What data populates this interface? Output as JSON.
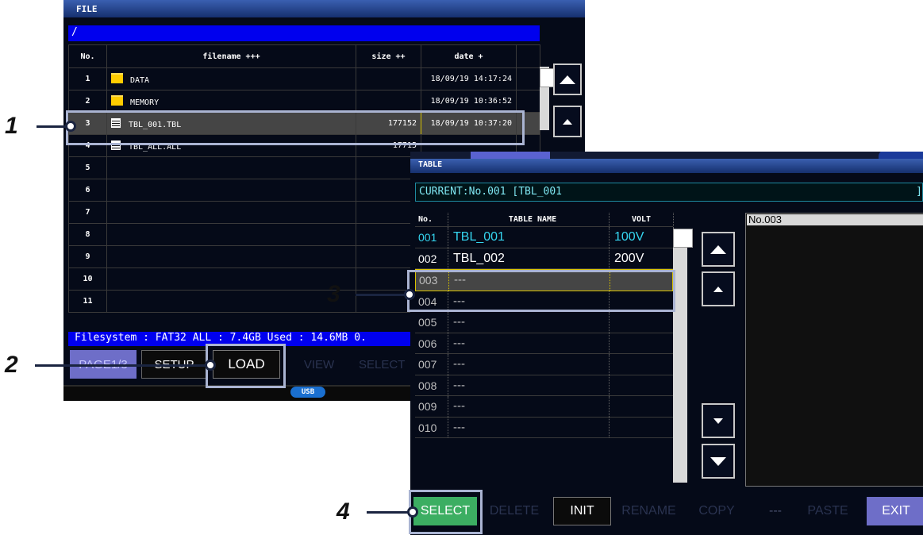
{
  "file_screen": {
    "title": "FILE",
    "path": "/",
    "columns": {
      "no": "No.",
      "filename": "filename +++",
      "size": "size ++",
      "date": "date +"
    },
    "rows": [
      {
        "no": "1",
        "icon": "folder-icon",
        "name": "DATA",
        "size": "",
        "date": "18/09/19 14:17:24"
      },
      {
        "no": "2",
        "icon": "folder-icon",
        "name": "MEMORY",
        "size": "",
        "date": "18/09/19 10:36:52"
      },
      {
        "no": "3",
        "icon": "table-file-icon",
        "name": "TBL_001.TBL",
        "size": "177152",
        "date": "18/09/19 10:37:20",
        "selected": true
      },
      {
        "no": "4",
        "icon": "table-file-icon",
        "name": "TBL_ALL.ALL",
        "size": "17715",
        "date": ""
      },
      {
        "no": "5",
        "name": "",
        "size": "",
        "date": ""
      },
      {
        "no": "6",
        "name": "",
        "size": "",
        "date": ""
      },
      {
        "no": "7",
        "name": "",
        "size": "",
        "date": ""
      },
      {
        "no": "8",
        "name": "",
        "size": "",
        "date": ""
      },
      {
        "no": "9",
        "name": "",
        "size": "",
        "date": ""
      },
      {
        "no": "10",
        "name": "",
        "size": "",
        "date": ""
      },
      {
        "no": "11",
        "name": "",
        "size": "",
        "date": ""
      }
    ],
    "filesystem": "Filesystem : FAT32  ALL : 7.4GB  Used : 14.6MB  0.",
    "buttons": {
      "page": "PAGE1/3",
      "setup": "SETUP",
      "load": "LOAD",
      "view": "VIEW",
      "select": "SELECT"
    },
    "usb": "USB"
  },
  "table_screen": {
    "title": "TABLE",
    "current": "CURRENT:No.001 [TBL_001",
    "current_end": "]",
    "columns": {
      "no": "No.",
      "name": "TABLE NAME",
      "volt": "VOLT"
    },
    "rows": [
      {
        "no": "001",
        "name": "TBL_001",
        "volt": "100V",
        "current": true
      },
      {
        "no": "002",
        "name": "TBL_002",
        "volt": "200V"
      },
      {
        "no": "003",
        "name": "---",
        "volt": "",
        "selected": true
      },
      {
        "no": "004",
        "name": "---",
        "volt": ""
      },
      {
        "no": "005",
        "name": "---",
        "volt": ""
      },
      {
        "no": "006",
        "name": "---",
        "volt": ""
      },
      {
        "no": "007",
        "name": "---",
        "volt": ""
      },
      {
        "no": "008",
        "name": "---",
        "volt": ""
      },
      {
        "no": "009",
        "name": "---",
        "volt": ""
      },
      {
        "no": "010",
        "name": "---",
        "volt": ""
      }
    ],
    "preview_label": "No.003",
    "buttons": {
      "select": "SELECT",
      "delete": "DELETE",
      "init": "INIT",
      "rename": "RENAME",
      "copy": "COPY",
      "dash": "---",
      "paste": "PASTE",
      "exit": "EXIT"
    }
  },
  "callouts": [
    "1",
    "2",
    "3",
    "4"
  ],
  "colors": {
    "accent_blue": "#0000ee",
    "select_green": "#3cae62",
    "exit_purple": "#6e6ec8",
    "current_cyan": "#35d6f0"
  }
}
